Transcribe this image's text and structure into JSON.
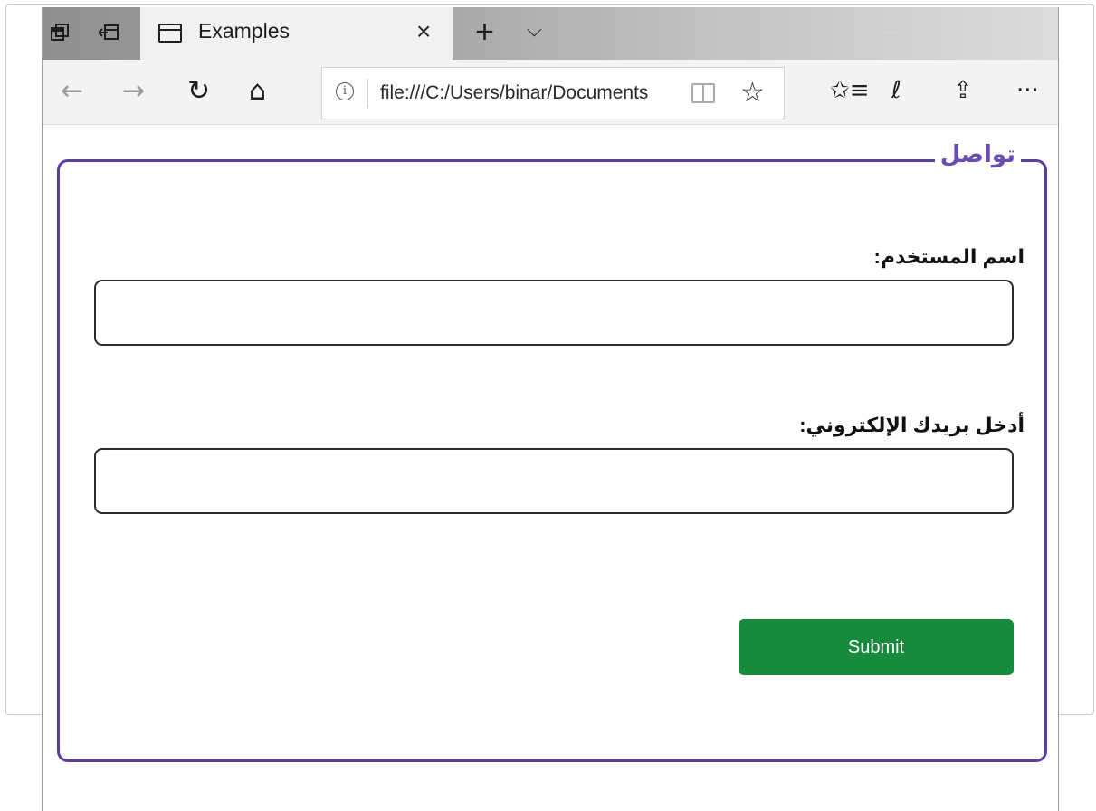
{
  "window": {
    "tab_title": "Examples",
    "tab_close": "×",
    "new_tab": "+",
    "tab_dropdown": "⌵",
    "controls": [
      "—",
      "☐",
      "✕"
    ]
  },
  "navbar": {
    "back": "←",
    "forward": "→",
    "refresh": "↻",
    "home": "⌂",
    "address": "file:///C:/Users/binar/Documents",
    "info": "i",
    "favorite": "☆",
    "favorites_list": "✩≡",
    "notes": "ℓ",
    "share": "⇪",
    "more": "···"
  },
  "form": {
    "legend": "تواصل",
    "username_label": "اسم المستخدم:",
    "username_value": "",
    "email_label": "أدخل بريدك الإلكتروني:",
    "email_value": "",
    "submit_label": "Submit"
  },
  "colors": {
    "fieldset_border": "#5b3d9e",
    "legend_text": "#6a4bb2",
    "submit_bg": "#178a3e"
  }
}
